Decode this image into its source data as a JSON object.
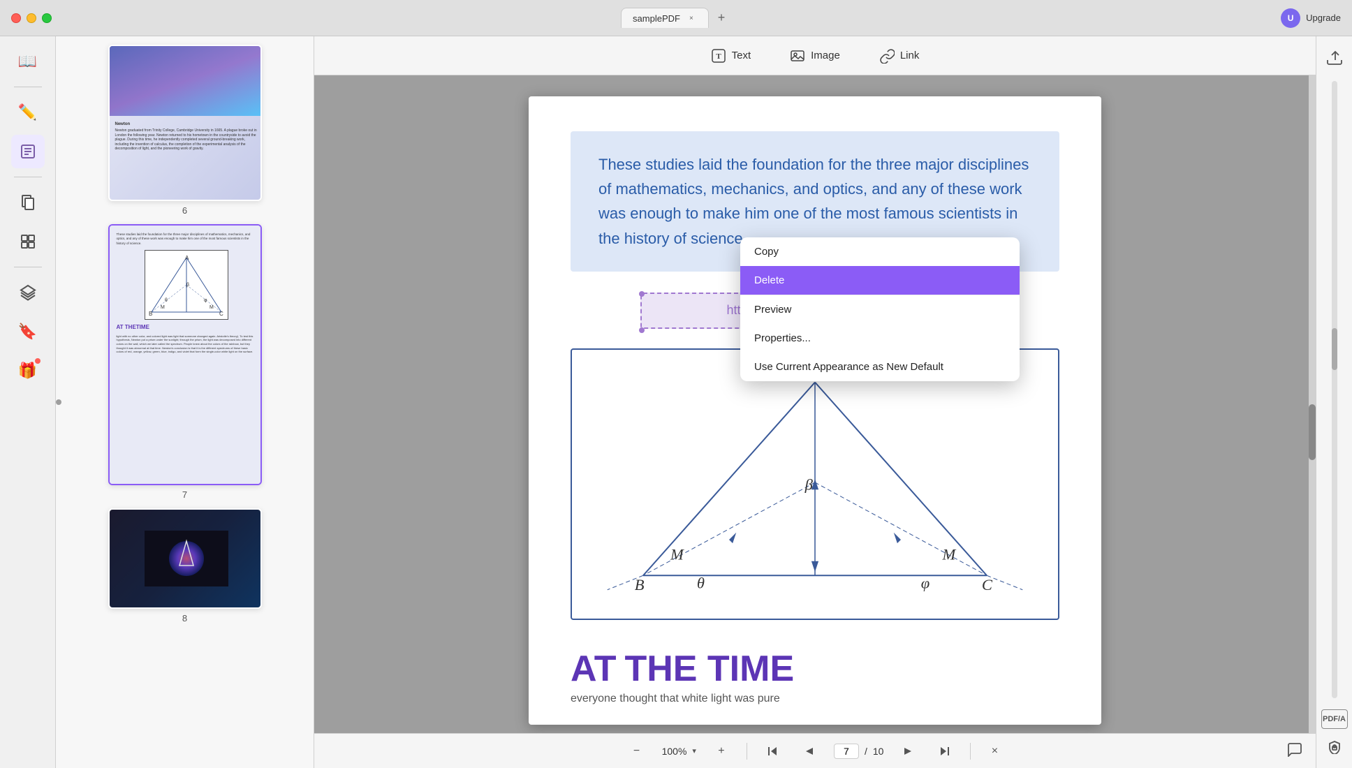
{
  "titlebar": {
    "tab_title": "samplePDF",
    "tab_close": "×",
    "tab_add": "+",
    "upgrade_label": "Upgrade"
  },
  "toolbar": {
    "text_label": "Text",
    "image_label": "Image",
    "link_label": "Link"
  },
  "sidebar": {
    "icons": [
      {
        "name": "reader-icon",
        "symbol": "📖",
        "active": false
      },
      {
        "name": "edit-icon",
        "symbol": "✏️",
        "active": false
      },
      {
        "name": "annotate-icon",
        "symbol": "📝",
        "active": true
      },
      {
        "name": "pages-icon",
        "symbol": "📄",
        "active": false
      },
      {
        "name": "organize-icon",
        "symbol": "🗂",
        "active": false
      },
      {
        "name": "layers-icon",
        "symbol": "⊞",
        "active": false
      },
      {
        "name": "bookmark-icon",
        "symbol": "🔖",
        "active": false
      },
      {
        "name": "gift-icon",
        "symbol": "🎁",
        "active": false,
        "badge": true
      }
    ]
  },
  "page_content": {
    "paragraph": "These studies laid the foundation for the three major disciplines of mathematics, mechanics, and optics, and any of these work was enough to make him one of the most famous scientists in the history of science.",
    "link_url": "https://updf.com/",
    "at_text": "AT",
    "thetime_text": "THE TIME",
    "subtitle": "everyone thought that white light was pure"
  },
  "context_menu": {
    "copy": "Copy",
    "delete": "Delete",
    "preview": "Preview",
    "properties": "Properties...",
    "use_current": "Use Current Appearance as New Default"
  },
  "bottom_bar": {
    "zoom_minus": "−",
    "zoom_level": "100%",
    "zoom_plus": "+",
    "page_first": "⏮",
    "page_prev": "↑",
    "page_current": "7",
    "page_separator": "/",
    "page_total": "10",
    "page_next": "↓",
    "page_last": "⏭",
    "close": "×"
  },
  "right_sidebar": {
    "icons": [
      {
        "name": "export-icon",
        "symbol": "↑"
      },
      {
        "name": "pdf-a-icon",
        "symbol": "A"
      },
      {
        "name": "security-icon",
        "symbol": "🔒"
      }
    ]
  },
  "thumbnails": [
    {
      "number": "6"
    },
    {
      "number": "7"
    },
    {
      "number": "8"
    }
  ]
}
